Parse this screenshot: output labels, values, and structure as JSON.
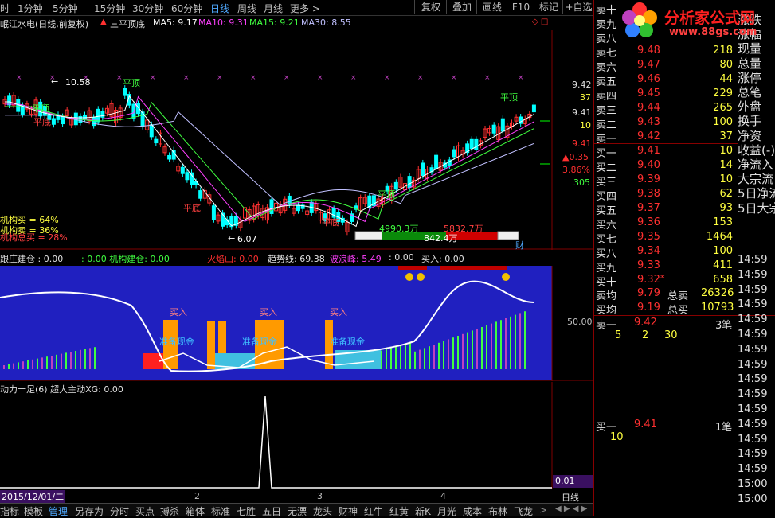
{
  "periods": [
    "时",
    "1分钟",
    "5分钟",
    "15分钟",
    "30分钟",
    "60分钟",
    "日线",
    "周线",
    "月线",
    "更多 >"
  ],
  "active_period": "日线",
  "top_buttons": [
    "复权",
    "叠加",
    "画线",
    "F10",
    "标记",
    "+自选"
  ],
  "info": {
    "title": "岷江水电(日线,前复权)",
    "pattern": "三平顶底",
    "ma5": "MA5: 9.17",
    "ma10": "MA10: 9.31",
    "ma15": "MA15: 9.21",
    "ma30": "MA30: 8.55"
  },
  "price_axis": [
    "9.42",
    "37",
    "9.41",
    "10",
    "9.41",
    "▲0.35",
    "3.86%",
    "305"
  ],
  "chart_labels": {
    "high": "10.58",
    "low": "6.07",
    "flat_top_1": "平顶",
    "flat_top_2": "平顶",
    "flat_bottom_1": "平底",
    "flat_bottom_2": "平底",
    "flat_bottom_3": "平底",
    "flat_top_3": "平顶",
    "flat_top_4": "平顶",
    "inst_buy": "机构买 = 64%",
    "inst_sell": "机构卖 = 36%",
    "inst_total": "机构总买 = 28%",
    "bar_left": "4990.3万",
    "bar_mid": "842.4万",
    "bar_right": "5832.7万",
    "wealth": "财"
  },
  "indicator1": {
    "follow": "跟庄建仓 : 0.00",
    "inst_build": ": 0.00  机构建仓: 0.00",
    "fire": "火焰山: 0.00",
    "trend": "趋势线: 69.38",
    "wave": "波浪峰: 5.49",
    "zero": ": 0.00",
    "buy": "买入: 0.00",
    "axis": "50.00",
    "buy_labels": [
      "买入",
      "买入",
      "买入"
    ],
    "cash_labels": [
      "准备现金",
      "准备现金",
      "准备现金"
    ]
  },
  "indicator2": {
    "label": "动力十足(6)  超大主动XG: 0.00",
    "axis": "0.01"
  },
  "date_bar": {
    "date": "2015/12/01/二",
    "month_ticks": [
      "2",
      "3",
      "4"
    ]
  },
  "bottom_tabs": [
    "指标",
    "模板",
    "管理",
    "另存为",
    "分时",
    "买点",
    "搏杀",
    "箱体",
    "标准",
    "七胜",
    "五日",
    "无漂",
    "龙头",
    "财神",
    "红牛",
    "红黄",
    "新K",
    "月光",
    "成本",
    "布林",
    "飞龙"
  ],
  "active_bottom_tab": "管理",
  "bottom_right": "日线",
  "logo": {
    "title": "分析家公式网",
    "url": "www.88gs.com"
  },
  "orderbook": {
    "sell": [
      {
        "label": "卖十",
        "price": "",
        "vol": ""
      },
      {
        "label": "卖九",
        "price": "",
        "vol": ""
      },
      {
        "label": "卖八",
        "price": "",
        "vol": ""
      },
      {
        "label": "卖七",
        "price": "9.48",
        "vol": "218"
      },
      {
        "label": "卖六",
        "price": "9.47",
        "vol": "80"
      },
      {
        "label": "卖五",
        "price": "9.46",
        "vol": "44"
      },
      {
        "label": "卖四",
        "price": "9.45",
        "vol": "229"
      },
      {
        "label": "卖三",
        "price": "9.44",
        "vol": "265"
      },
      {
        "label": "卖二",
        "price": "9.43",
        "vol": "100"
      },
      {
        "label": "卖一",
        "price": "9.42",
        "vol": "37"
      }
    ],
    "buy": [
      {
        "label": "买一",
        "price": "9.41",
        "vol": "10"
      },
      {
        "label": "买二",
        "price": "9.40",
        "vol": "14"
      },
      {
        "label": "买三",
        "price": "9.39",
        "vol": "10"
      },
      {
        "label": "买四",
        "price": "9.38",
        "vol": "62"
      },
      {
        "label": "买五",
        "price": "9.37",
        "vol": "93"
      },
      {
        "label": "买六",
        "price": "9.36",
        "vol": "153"
      },
      {
        "label": "买七",
        "price": "9.35",
        "vol": "1464"
      },
      {
        "label": "买八",
        "price": "9.34",
        "vol": "100"
      },
      {
        "label": "买九",
        "price": "9.33",
        "vol": "411"
      },
      {
        "label": "买十",
        "price": "9.32",
        "vol": "658"
      }
    ],
    "buy10_mark": "*",
    "avg_sell": {
      "label": "卖均",
      "price": "9.79",
      "tlabel": "总卖",
      "total": "26326"
    },
    "avg_buy": {
      "label": "买均",
      "price": "9.19",
      "tlabel": "总买",
      "total": "10793"
    },
    "sell1_detail": {
      "label": "卖一",
      "price": "9.42",
      "count": "3笔",
      "queue": [
        "5",
        "2",
        "30"
      ]
    },
    "buy1_detail": {
      "label": "买一",
      "price": "9.41",
      "count": "1笔",
      "queue": [
        "10"
      ]
    }
  },
  "stats_labels": [
    "涨跌",
    "涨幅",
    "现量",
    "总量",
    "涨停",
    "总笔",
    "外盘",
    "换手",
    "净资",
    "收益(-)",
    "净流入",
    "大宗流",
    "5日净流",
    "5日大宗"
  ],
  "time_ticks": [
    "14:59",
    "14:59",
    "14:59",
    "14:59",
    "14:59",
    "14:59",
    "14:59",
    "14:59",
    "14:59",
    "14:59",
    "14:59",
    "14:59",
    "14:59",
    "14:59",
    "14:59",
    "15:00",
    "15:00"
  ],
  "colors": {
    "up": "#ff3030",
    "down": "#00ffff",
    "ma5": "#ffffff",
    "ma10": "#ff40ff",
    "ma15": "#40ff40",
    "ma30": "#c0c0ff",
    "panel_blue": "#2020c0"
  }
}
